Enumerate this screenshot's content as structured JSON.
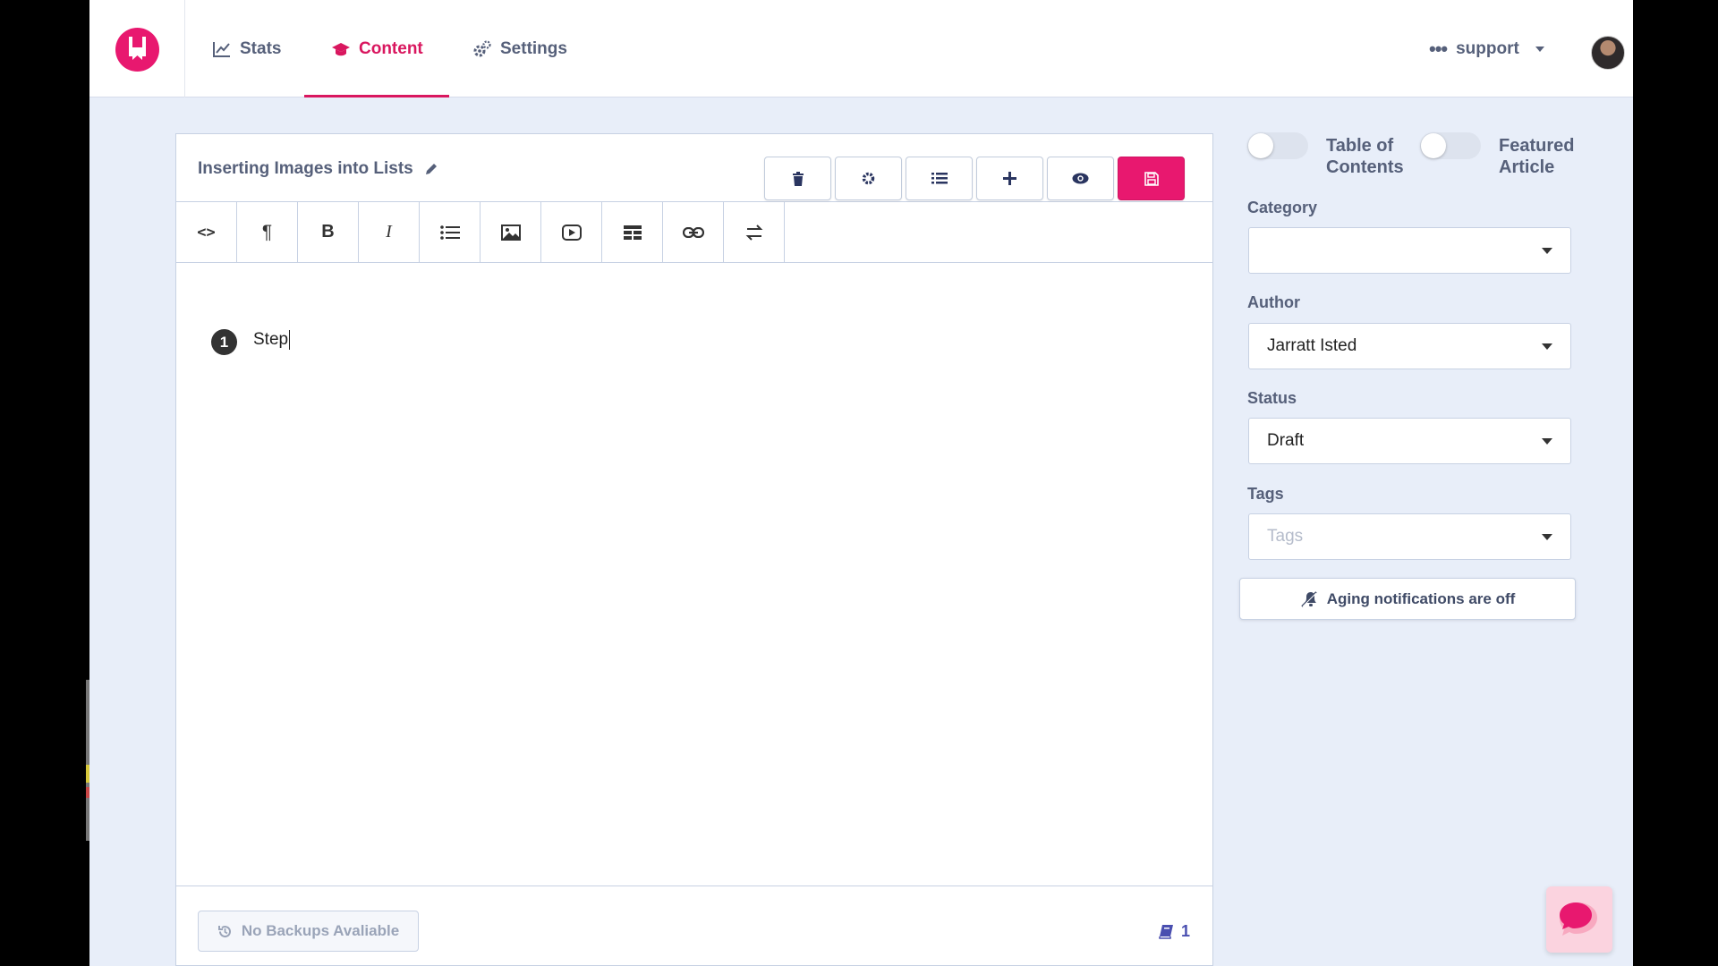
{
  "nav": {
    "tabs": [
      {
        "label": "Stats",
        "icon": "chart-line-icon"
      },
      {
        "label": "Content",
        "icon": "graduation-cap-icon",
        "active": true
      },
      {
        "label": "Settings",
        "icon": "cogs-icon"
      }
    ],
    "user_label": "support"
  },
  "editor": {
    "title": "Inserting Images into Lists",
    "actions": [
      "trash-icon",
      "cog-icon",
      "list-icon",
      "plus-icon",
      "eye-icon",
      "save-icon"
    ],
    "tools": [
      "code-icon",
      "paragraph-icon",
      "bold-icon",
      "italic-icon",
      "bullet-list-icon",
      "image-icon",
      "video-icon",
      "table-icon",
      "link-icon",
      "swap-icon"
    ],
    "step_number": "1",
    "step_text": "Step",
    "backup_label": "No Backups Avaliable",
    "word_count": "1"
  },
  "sidebar": {
    "toggle_toc": "Table of Contents",
    "toggle_featured": "Featured Article",
    "category_label": "Category",
    "category_value": "",
    "author_label": "Author",
    "author_value": "Jarratt Isted",
    "status_label": "Status",
    "status_value": "Draft",
    "tags_label": "Tags",
    "tags_placeholder": "Tags",
    "aging_label": "Aging notifications are off"
  },
  "colors": {
    "accent": "#e8186f",
    "nav_text": "#56607a",
    "background": "#e8eef9"
  }
}
